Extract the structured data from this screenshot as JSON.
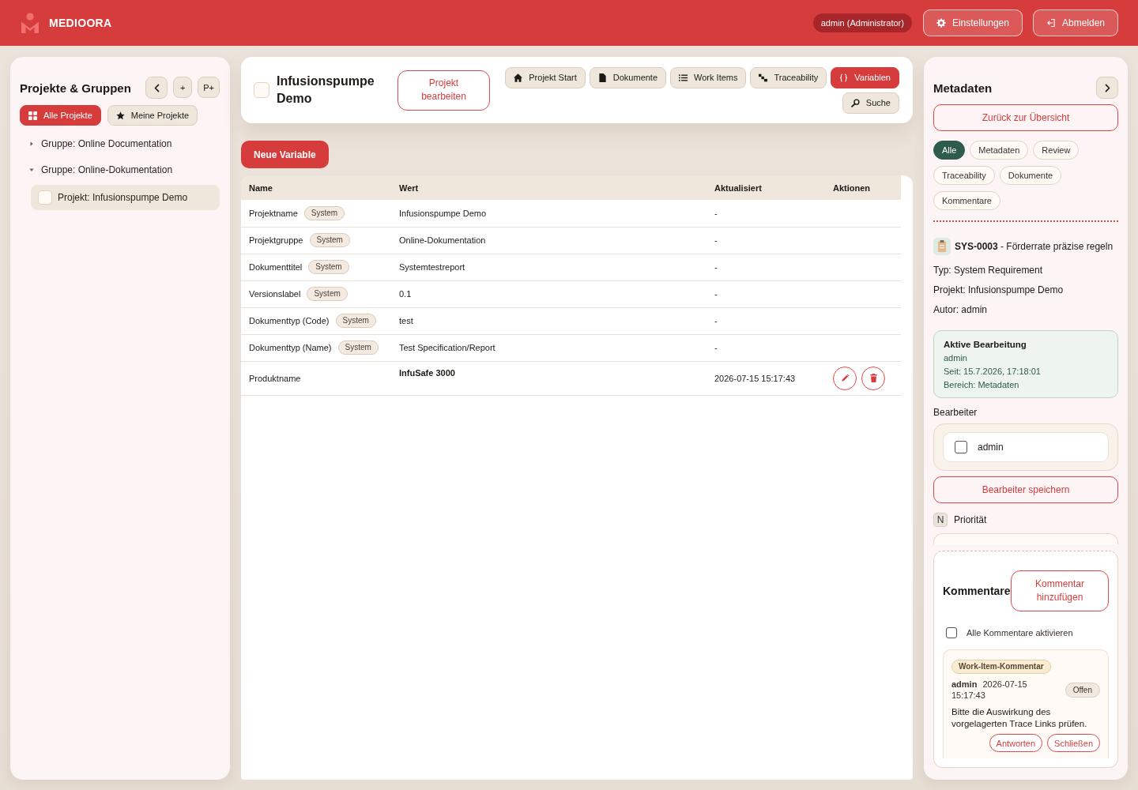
{
  "header": {
    "brand": "MEDIOORA",
    "user_badge": "admin (Administrator)",
    "buttons": [
      {
        "kind": "settings",
        "label": "Einstellungen"
      },
      {
        "kind": "logout",
        "label": "Abmelden"
      }
    ]
  },
  "sidebar": {
    "title": "Projekte & Gruppen",
    "tool_buttons": [
      {
        "kind": "collapse"
      },
      {
        "kind": "text",
        "label": "+"
      },
      {
        "kind": "text",
        "label": "P+"
      }
    ],
    "filters": [
      {
        "kind": "all",
        "label": "Alle Projekte",
        "selected": true
      },
      {
        "kind": "mine",
        "label": "Meine Projekte",
        "selected": false
      }
    ],
    "tree": [
      {
        "label": "Gruppe: Online Documentation",
        "expanded": false,
        "selected": false
      },
      {
        "label": "Gruppe: Online-Dokumentation",
        "expanded": true,
        "selected": false,
        "children": [
          {
            "label": "Projekt: Infusionspumpe Demo",
            "checked": false,
            "selected": true
          }
        ]
      }
    ]
  },
  "project": {
    "checked": false,
    "title": "Infusionspumpe Demo",
    "edit_button": "Projekt bearbeiten",
    "nav": [
      {
        "kind": "start",
        "label": "Projekt Start",
        "selected": false
      },
      {
        "kind": "documents",
        "label": "Dokumente",
        "selected": false
      },
      {
        "kind": "work_items",
        "label": "Work Items",
        "selected": false
      },
      {
        "kind": "traceability",
        "label": "Traceability",
        "selected": false
      },
      {
        "kind": "variables",
        "label": "Variablen",
        "selected": true
      },
      {
        "kind": "search",
        "label": "Suche",
        "selected": false
      }
    ]
  },
  "variables": {
    "new_button": "Neue Variable",
    "table": {
      "columns": [
        "Name",
        "Wert",
        "Aktualisiert",
        "Aktionen"
      ],
      "rows": [
        {
          "kind": "system",
          "name": "Projektname",
          "tag": "System",
          "value": "Infusionspumpe Demo",
          "updated": "-"
        },
        {
          "kind": "system",
          "name": "Projektgruppe",
          "tag": "System",
          "value": "Online-Dokumentation",
          "updated": "-"
        },
        {
          "kind": "system",
          "name": "Dokumenttitel",
          "tag": "System",
          "value": "Systemtestreport",
          "updated": "-"
        },
        {
          "kind": "system",
          "name": "Versionslabel",
          "tag": "System",
          "value": "0.1",
          "updated": "-"
        },
        {
          "kind": "system",
          "name": "Dokumenttyp (Code)",
          "tag": "System",
          "value": "test",
          "updated": "-"
        },
        {
          "kind": "system",
          "name": "Dokumenttyp (Name)",
          "tag": "System",
          "value": "Test Specification/Report",
          "updated": "-"
        },
        {
          "kind": "custom",
          "name": "Produktname",
          "value": "InfuSafe 3000",
          "updated": "2026-07-15 15:17:43"
        }
      ]
    }
  },
  "metadata": {
    "title": "Metadaten",
    "back_button": "Zurück zur Übersicht",
    "filters": [
      {
        "label": "Alle",
        "selected": true
      },
      {
        "label": "Metadaten",
        "selected": false
      },
      {
        "label": "Review",
        "selected": false
      },
      {
        "label": "Traceability",
        "selected": false
      },
      {
        "label": "Dokumente",
        "selected": false
      },
      {
        "label": "Kommentare",
        "selected": false
      }
    ],
    "item": "**SYS-0003** - Förderrate präzise regeln",
    "details": [
      "Typ: System Requirement",
      "Projekt: Infusionspumpe Demo",
      "Autor: admin"
    ],
    "active_edit": {
      "title": "Aktive Bearbeitung",
      "lines": [
        "admin",
        "Seit: 15.7.2026, 17:18:01",
        "Bereich: Metadaten"
      ]
    },
    "editors": {
      "label": "Bearbeiter",
      "options": [
        {
          "label": "admin",
          "checked": false
        }
      ],
      "save_button": "Bearbeiter speichern"
    },
    "priority": {
      "badge": "N",
      "label": "Priorität"
    },
    "comments": {
      "title": "Kommentare",
      "add_button": "Kommentar hinzufügen",
      "toggle": {
        "label": "Alle Kommentare aktivieren",
        "checked": false
      },
      "items": [
        {
          "tag": "Work-Item-Kommentar",
          "author": "admin",
          "time": "2026-07-15 15:17:43",
          "status": "Offen",
          "text": "Bitte die Auswirkung des vorgelagerten Trace Links prüfen.",
          "actions": [
            "Antworten",
            "Schließen"
          ]
        }
      ]
    }
  }
}
